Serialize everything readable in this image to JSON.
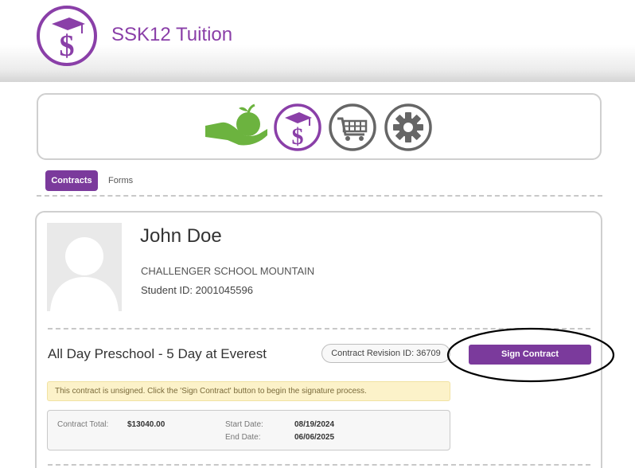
{
  "app": {
    "title": "SSK12 Tuition"
  },
  "colors": {
    "brand_purple": "#7b3a9c",
    "logo_purple": "#8a3fa8",
    "apple_green": "#6cb33f",
    "icon_gray": "#666666",
    "alert_bg": "#fcf2c9"
  },
  "nav_icons": [
    "apple-hand-icon",
    "tuition-dollar-icon",
    "shopping-cart-icon",
    "gear-icon"
  ],
  "tabs": {
    "contracts": "Contracts",
    "forms": "Forms"
  },
  "student": {
    "name": "John Doe",
    "school": "CHALLENGER SCHOOL MOUNTAIN",
    "id_label": "Student ID: 2001045596"
  },
  "contract": {
    "program": "All Day Preschool - 5 Day at Everest",
    "revision": "Contract Revision ID: 36709",
    "sign_label": "Sign Contract",
    "alert": "This contract is unsigned. Click the 'Sign Contract' button to begin the signature process.",
    "total_label": "Contract Total:",
    "total_value": "$13040.00",
    "start_label": "Start Date:",
    "start_value": "08/19/2024",
    "end_label": "End Date:",
    "end_value": "06/06/2025"
  }
}
